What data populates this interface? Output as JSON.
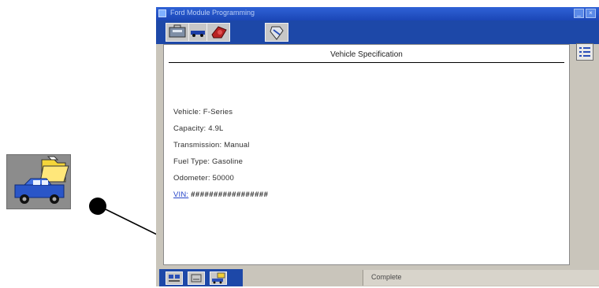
{
  "window": {
    "title": "Ford Module Programming"
  },
  "panel": {
    "header": "Vehicle Specification",
    "rows": [
      {
        "label": "Vehicle:",
        "value": "F-Series"
      },
      {
        "label": "Capacity:",
        "value": "4.9L"
      },
      {
        "label": "Transmission:",
        "value": "Manual"
      },
      {
        "label": "Fuel Type:",
        "value": "Gasoline"
      },
      {
        "label": "Odometer:",
        "value": "50000"
      }
    ],
    "vin": {
      "label": "VIN:",
      "value": "#################"
    }
  },
  "status": {
    "text": "Complete"
  },
  "icons": {
    "toolbar": [
      "vehicle-toolbox-icon",
      "car-icon",
      "engine-icon",
      "tools-icon"
    ],
    "side": "list-icon",
    "status_tabs": [
      "vehicle-id-icon",
      "module-icon",
      "vehicle-folder-icon"
    ],
    "callout": "vehicle-folder-icon"
  }
}
